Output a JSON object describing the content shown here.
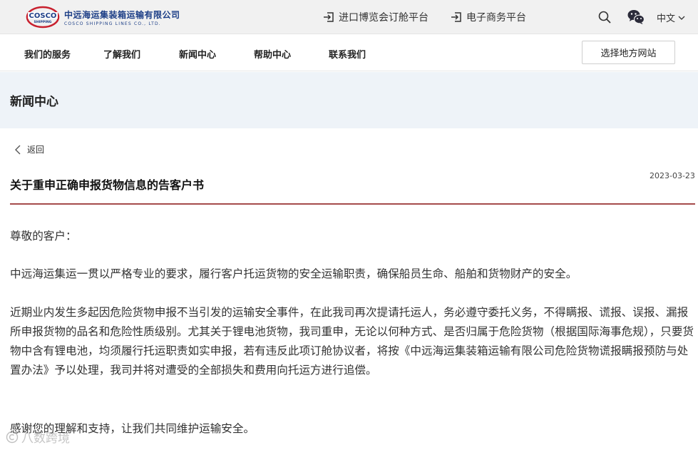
{
  "header": {
    "logo": {
      "brand_text": "COSCO SHIPPING",
      "company_cn": "中远海运集装箱运输有限公司",
      "company_en": "COSCO SHIPPING LINES CO., LTD."
    },
    "links": [
      {
        "label": "进口博览会订舱平台",
        "icon": "login-icon"
      },
      {
        "label": "电子商务平台",
        "icon": "login-icon"
      }
    ],
    "search_icon": "search-icon",
    "wechat_icon": "wechat-icon",
    "language": "中文"
  },
  "nav": {
    "items": [
      {
        "label": "我们的服务"
      },
      {
        "label": "了解我们"
      },
      {
        "label": "新闻中心"
      },
      {
        "label": "帮助中心"
      },
      {
        "label": "联系我们"
      }
    ],
    "region_button": "选择地方网站"
  },
  "banner": {
    "title": "新闻中心"
  },
  "article": {
    "back_label": "返回",
    "title": "关于重申正确申报货物信息的告客户书",
    "date": "2023-03-23",
    "paragraphs": [
      "尊敬的客户：",
      "中远海运集运一贯以严格专业的要求，履行客户托运货物的安全运输职责，确保船员生命、船舶和货物财产的安全。",
      "近期业内发生多起因危险货物申报不当引发的运输安全事件，在此我司再次提请托运人，务必遵守委托义务，不得瞒报、谎报、误报、漏报所申报货物的品名和危险性质级别。尤其关于锂电池货物，我司重申，无论以何种方式、是否归属于危险货物（根据国际海事危规），只要货物中含有锂电池，均须履行托运职责如实申报，若有违反此项订舱协议者，将按《中远海运集装箱运输有限公司危险货物谎报瞒报预防与处置办法》予以处理，我司并将对遭受的全部损失和费用向托运方进行追偿。",
      "感谢您的理解和支持，让我们共同维护运输安全。"
    ]
  },
  "watermark": {
    "text": "八数跨境"
  },
  "colors": {
    "topbar_bg": "#f1f1f1",
    "banner_bg": "#eef3f8",
    "divider": "#a54b4b",
    "brand_blue": "#1d3f87",
    "brand_red": "#c8202e"
  }
}
